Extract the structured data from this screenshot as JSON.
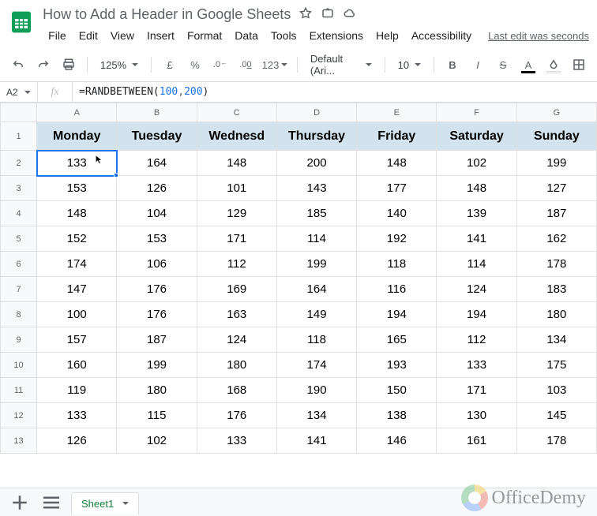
{
  "doc": {
    "title": "How to Add a Header in Google Sheets",
    "last_edit": "Last edit was seconds"
  },
  "menu": [
    "File",
    "Edit",
    "View",
    "Insert",
    "Format",
    "Data",
    "Tools",
    "Extensions",
    "Help",
    "Accessibility"
  ],
  "toolbar": {
    "zoom": "125%",
    "currency": "£",
    "percent": "%",
    "dec_down": ".0",
    "dec_up": ".00",
    "numfmt": "123",
    "font": "Default (Ari...",
    "fontsize": "10"
  },
  "namebox": "A2",
  "fx_label": "fx",
  "formula": {
    "fn": "RANDBETWEEN",
    "arg1": "100",
    "arg2": "200"
  },
  "columns": [
    "A",
    "B",
    "C",
    "D",
    "E",
    "F",
    "G"
  ],
  "header_row": [
    "Monday",
    "Tuesday",
    "Wednesd",
    "Thursday",
    "Friday",
    "Saturday",
    "Sunday"
  ],
  "rows": [
    [
      133,
      164,
      148,
      200,
      148,
      102,
      199
    ],
    [
      153,
      126,
      101,
      143,
      177,
      148,
      127
    ],
    [
      148,
      104,
      129,
      185,
      140,
      139,
      187
    ],
    [
      152,
      153,
      171,
      114,
      192,
      141,
      162
    ],
    [
      174,
      106,
      112,
      199,
      118,
      114,
      178
    ],
    [
      147,
      176,
      169,
      164,
      116,
      124,
      183
    ],
    [
      100,
      176,
      163,
      149,
      194,
      194,
      180
    ],
    [
      157,
      187,
      124,
      118,
      165,
      112,
      134
    ],
    [
      160,
      199,
      180,
      174,
      193,
      133,
      175
    ],
    [
      119,
      180,
      168,
      190,
      150,
      171,
      103
    ],
    [
      133,
      115,
      176,
      134,
      138,
      130,
      145
    ],
    [
      126,
      102,
      133,
      141,
      146,
      161,
      178
    ]
  ],
  "selected": {
    "row": 2,
    "col": "A"
  },
  "sheet_tab": "Sheet1",
  "watermark": "OfficeDemy"
}
